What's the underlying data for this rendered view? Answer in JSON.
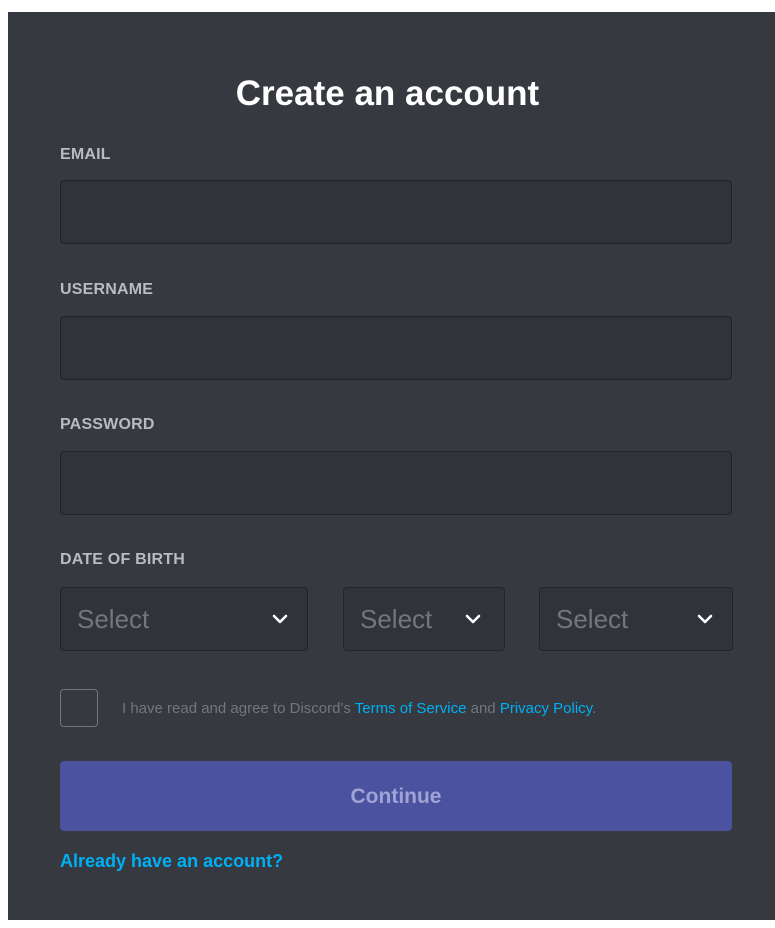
{
  "form": {
    "title": "Create an account",
    "email": {
      "label": "EMAIL",
      "value": ""
    },
    "username": {
      "label": "USERNAME",
      "value": ""
    },
    "password": {
      "label": "PASSWORD",
      "value": ""
    },
    "dob": {
      "label": "DATE OF BIRTH",
      "month_placeholder": "Select",
      "day_placeholder": "Select",
      "year_placeholder": "Select"
    },
    "terms": {
      "checked": false,
      "prefix": "I have read and agree to Discord's ",
      "tos_link": "Terms of Service",
      "middle": " and ",
      "privacy_link": "Privacy Policy",
      "suffix": "."
    },
    "continue_label": "Continue",
    "login_link": "Already have an account?"
  },
  "colors": {
    "background": "#36393f",
    "input_background": "#303339",
    "button": "#4b53a0",
    "link": "#00b0f4",
    "label": "#b9bbbe"
  },
  "icons": {
    "select_chevron": "chevron-down-icon"
  }
}
